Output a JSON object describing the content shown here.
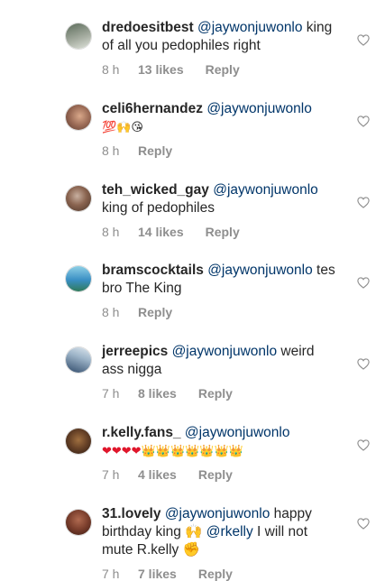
{
  "comments": [
    {
      "username": "dredoesitbest",
      "mention": "@jaywonjuwonlo",
      "text": " king of all you pedophiles right",
      "time": "8 h",
      "likes": "13 likes",
      "reply": "Reply",
      "avatar_colors": [
        "#5b6b5a",
        "#a9b0a4"
      ]
    },
    {
      "username": "celi6hernandez",
      "mention": "@jaywonjuwonlo",
      "text": "",
      "emojis": "💯🙌😘",
      "time": "8 h",
      "likes": "",
      "reply": "Reply",
      "avatar_colors": [
        "#7a4a3a",
        "#d9a88a"
      ]
    },
    {
      "username": "teh_wicked_gay",
      "mention": "@jaywonjuwonlo",
      "text": " king of pedophiles",
      "time": "8 h",
      "likes": "14 likes",
      "reply": "Reply",
      "avatar_colors": [
        "#6b4e3c",
        "#b8a090"
      ]
    },
    {
      "username": "bramscocktails",
      "mention": "@jaywonjuwonlo",
      "text": " tes bro The King",
      "time": "8 h",
      "likes": "",
      "reply": "Reply",
      "avatar_colors": [
        "#3a8fc4",
        "#8fd0e6"
      ]
    },
    {
      "username": "jerreepics",
      "mention": "@jaywonjuwonlo",
      "text": " weird ass nigga",
      "time": "7 h",
      "likes": "8 likes",
      "reply": "Reply",
      "avatar_colors": [
        "#2f4a6a",
        "#9db4c8"
      ]
    },
    {
      "username": "r.kelly.fans_",
      "mention": "@jaywonjuwonlo",
      "text": "",
      "emojis": "❤❤❤❤👑👑👑👑👑👑👑",
      "time": "7 h",
      "likes": "4 likes",
      "reply": "Reply",
      "avatar_colors": [
        "#3b2418",
        "#a07040"
      ]
    },
    {
      "username": "31.lovely",
      "mention": "@jaywonjuwonlo",
      "text": " happy birthday king 🙌 ",
      "mention2": "@rkelly",
      "text2": " I will not mute R.kelly ✊",
      "time": "7 h",
      "likes": "7 likes",
      "reply": "Reply",
      "avatar_colors": [
        "#5a2a1e",
        "#b06a50"
      ]
    }
  ],
  "colors": {
    "username": "#262626",
    "mention": "#003569",
    "meta": "#8e8e8e",
    "heart_outline": "#8e8e8e"
  },
  "icons": {
    "like": "heart-outline-icon"
  }
}
